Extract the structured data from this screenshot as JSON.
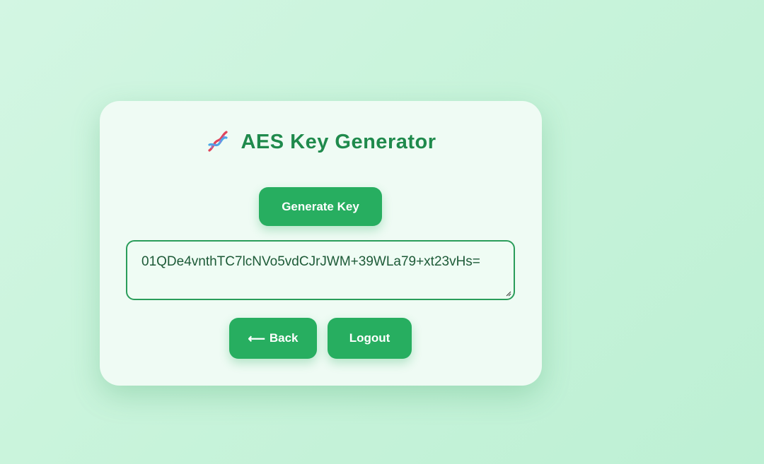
{
  "card": {
    "title": "AES Key Generator",
    "title_icon": "dna-icon",
    "generate_label": "Generate Key",
    "key_value": "01QDe4vnthTC7lcNVo5vdCJrJWM+39WLa79+xt23vHs=",
    "back_arrow": "⟵",
    "back_label": "Back",
    "logout_label": "Logout"
  },
  "colors": {
    "accent": "#27ae60",
    "title": "#1f8a4c",
    "card_bg": "#effbf4",
    "page_bg": "#c7f3da"
  }
}
